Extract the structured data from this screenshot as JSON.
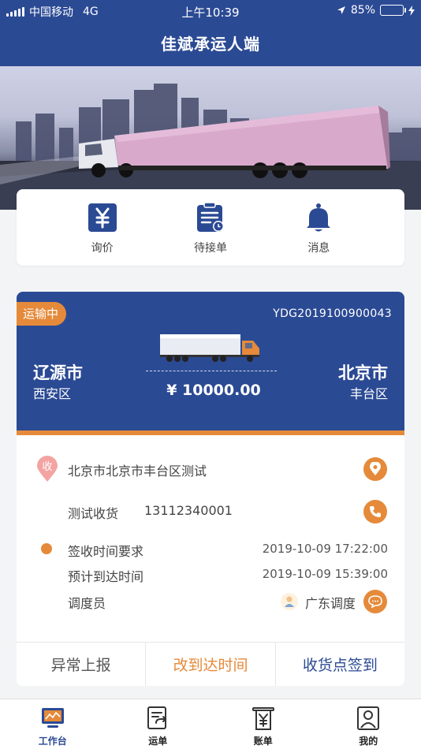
{
  "status_bar": {
    "carrier": "中国移动",
    "network": "4G",
    "time": "上午10:39",
    "battery": "85%",
    "battery_level": 0.85
  },
  "header": {
    "title": "佳斌承运人端"
  },
  "quick_actions": [
    {
      "label": "询价",
      "icon": "yen-icon"
    },
    {
      "label": "待接单",
      "icon": "clipboard-clock-icon"
    },
    {
      "label": "消息",
      "icon": "bell-icon"
    }
  ],
  "order": {
    "status": "运输中",
    "number": "YDG2019100900043",
    "from_city": "辽源市",
    "from_district": "西安区",
    "to_city": "北京市",
    "to_district": "丰台区",
    "price": "¥ 10000.00",
    "address_tag": "收",
    "address": "北京市北京市丰台区测试",
    "contact_name": "测试收货",
    "contact_phone": "13112340001",
    "sign_time_label": "签收时间要求",
    "sign_time_value": "2019-10-09 17:22:00",
    "eta_label": "预计到达时间",
    "eta_value": "2019-10-09 15:39:00",
    "dispatcher_label": "调度员",
    "dispatcher_name": "广东调度",
    "actions": {
      "report": "异常上报",
      "change_time": "改到达时间",
      "checkin": "收货点签到"
    }
  },
  "colors": {
    "primary": "#2b4a94",
    "accent": "#e58a3a"
  },
  "tabbar": [
    {
      "label": "工作台",
      "icon": "monitor-icon",
      "active": true
    },
    {
      "label": "运单",
      "icon": "waybill-icon"
    },
    {
      "label": "账单",
      "icon": "bill-icon"
    },
    {
      "label": "我的",
      "icon": "profile-icon"
    }
  ]
}
